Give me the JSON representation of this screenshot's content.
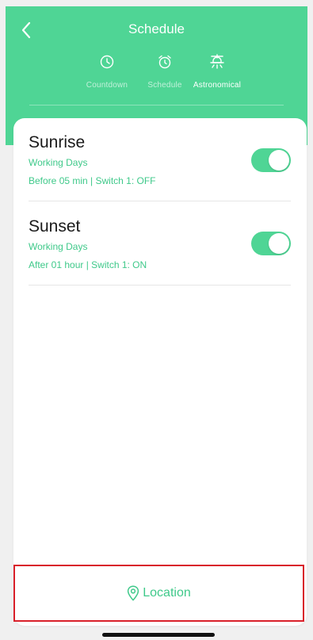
{
  "header": {
    "title": "Schedule",
    "back_icon": "chevron-left-icon"
  },
  "tabs": [
    {
      "label": "Countdown",
      "icon": "clock-icon",
      "active": false
    },
    {
      "label": "Schedule",
      "icon": "alarm-clock-icon",
      "active": false
    },
    {
      "label": "Astronomical",
      "icon": "sunrise-icon",
      "active": true
    }
  ],
  "items": [
    {
      "title": "Sunrise",
      "days": "Working Days",
      "detail": "Before 05 min | Switch 1: OFF",
      "enabled": true
    },
    {
      "title": "Sunset",
      "days": "Working Days",
      "detail": "After 01 hour | Switch 1: ON",
      "enabled": true
    }
  ],
  "location": {
    "label": "Location",
    "icon": "location-pin-icon"
  },
  "colors": {
    "accent": "#4fd595",
    "accent_text": "#3fc98a",
    "highlight_border": "#d9202a"
  }
}
